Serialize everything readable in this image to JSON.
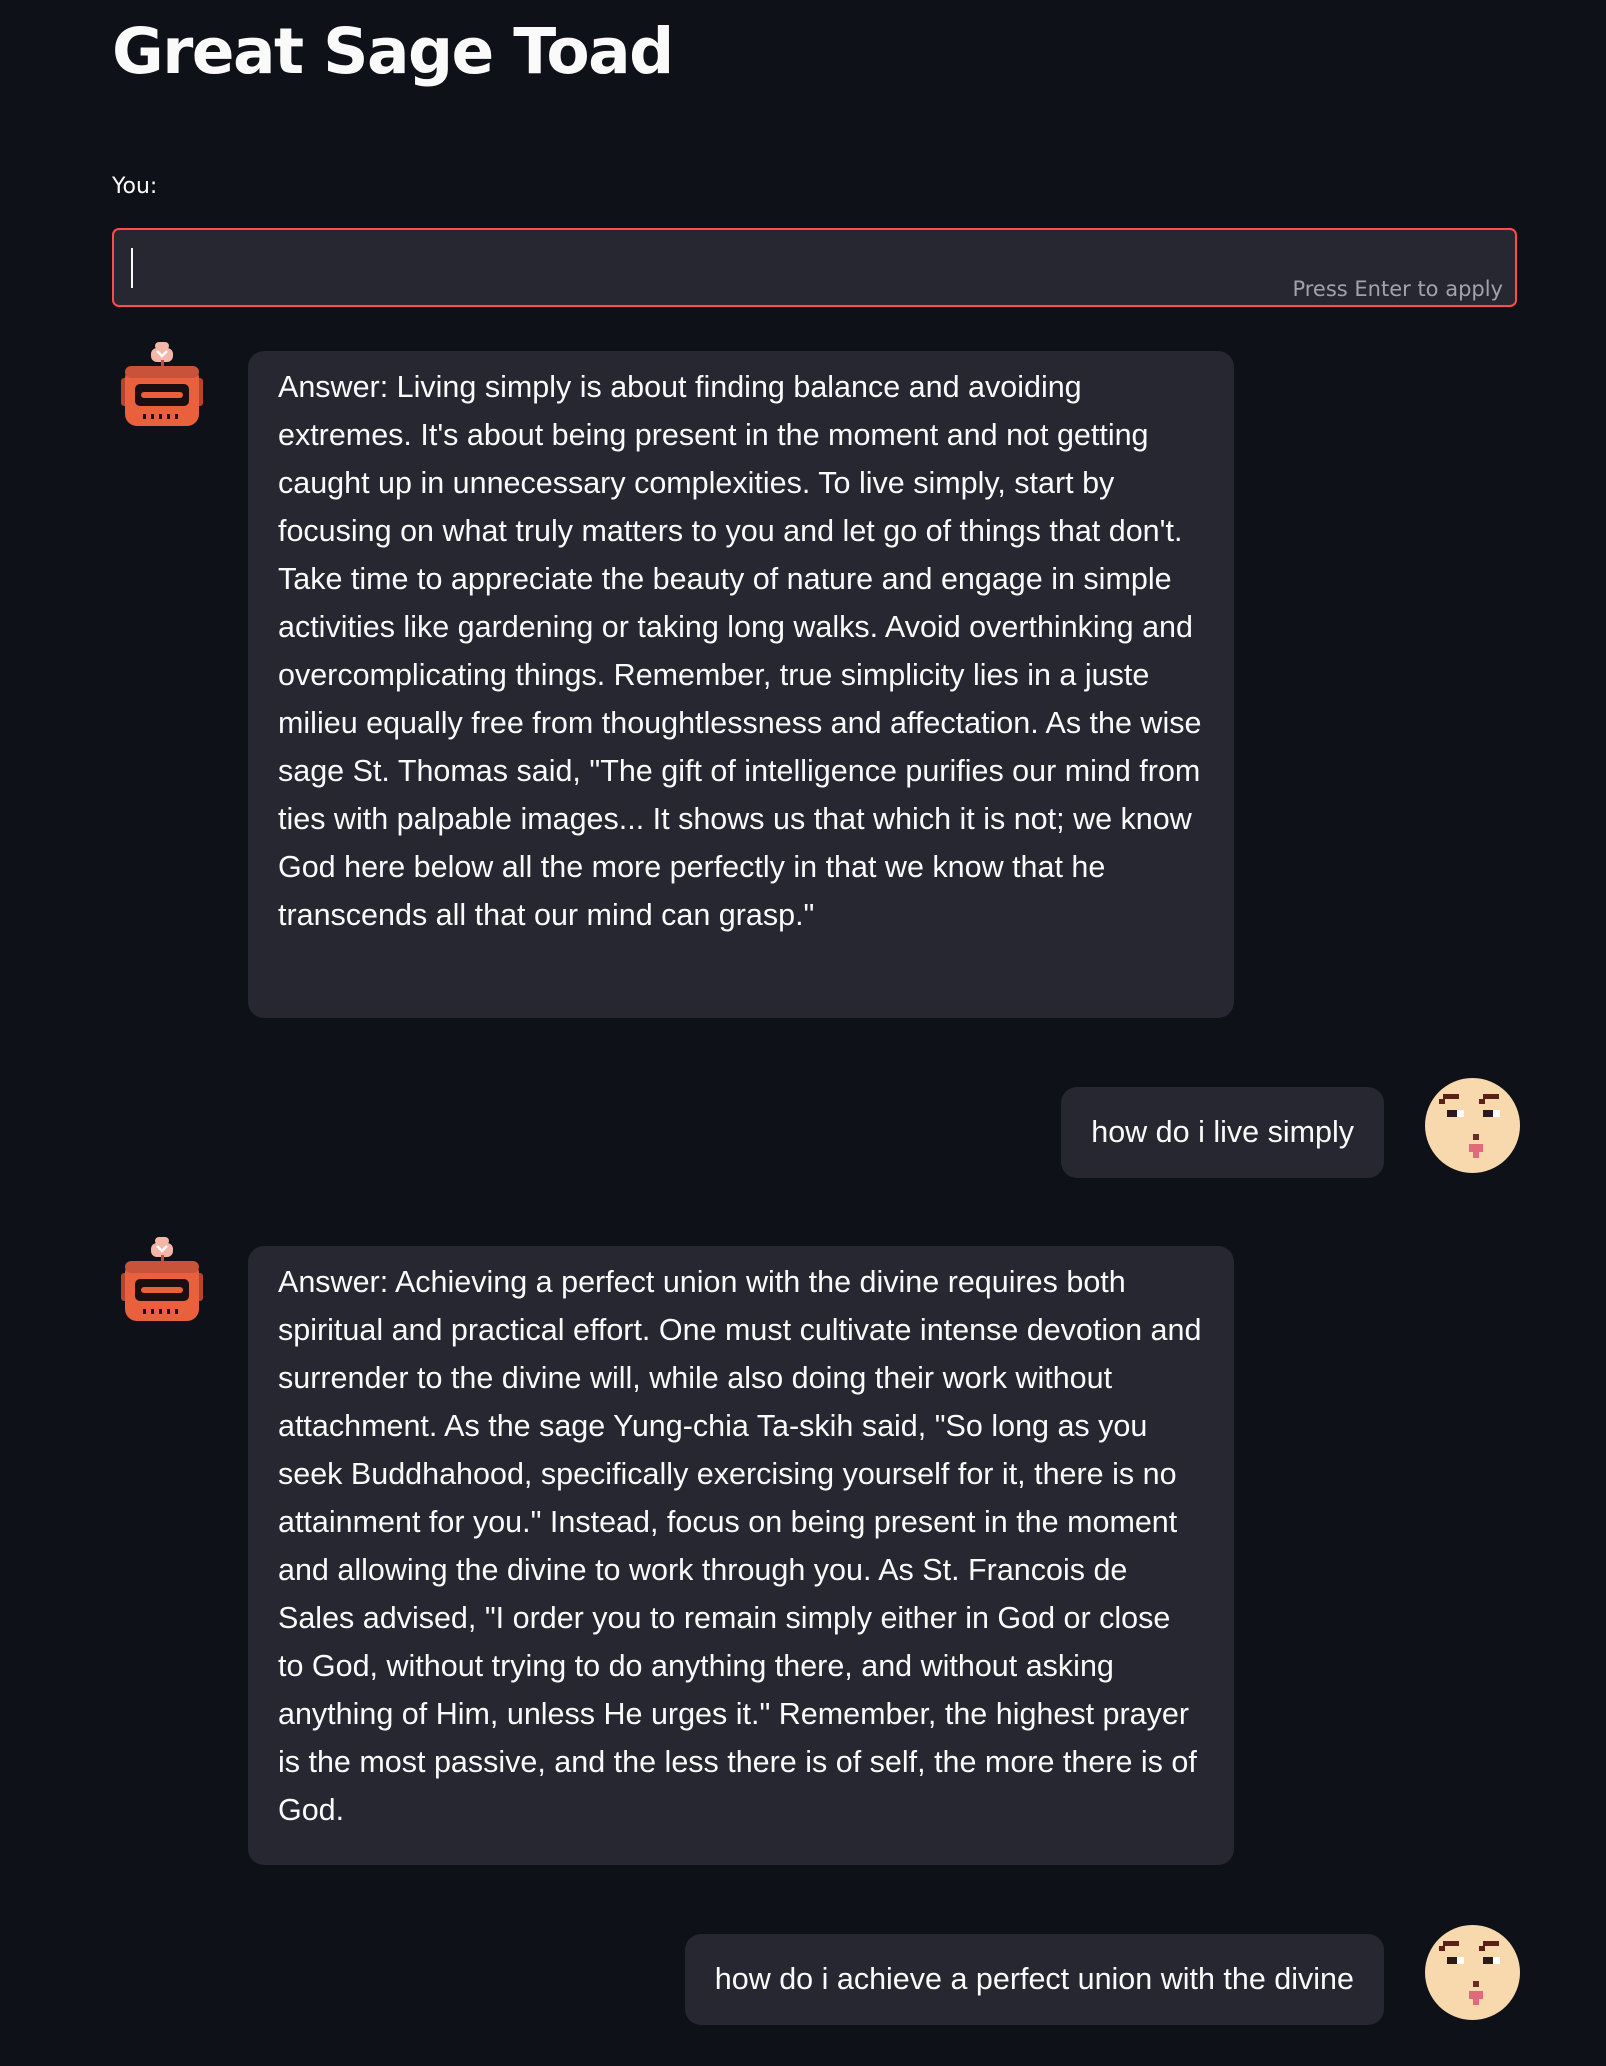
{
  "app": {
    "title": "Great Sage Toad"
  },
  "input": {
    "label": "You:",
    "value": "",
    "hint": "Press Enter to apply"
  },
  "messages": [
    {
      "role": "assistant",
      "avatar": "robot-avatar-icon",
      "text": "Answer: Living simply is about finding balance and avoiding extremes. It's about being present in the moment and not getting caught up in unnecessary complexities. To live simply, start by focusing on what truly matters to you and let go of things that don't. Take time to appreciate the beauty of nature and engage in simple activities like gardening or taking long walks. Avoid overthinking and overcomplicating things. Remember, true simplicity lies in a juste milieu equally free from thoughtlessness and affectation. As the wise sage St. Thomas said, \"The gift of intelligence purifies our mind from ties with palpable images... It shows us that which it is not; we know God here below all the more perfectly in that we know that he transcends all that our mind can grasp.\""
    },
    {
      "role": "user",
      "avatar": "face-avatar-icon",
      "text": "how do i live simply"
    },
    {
      "role": "assistant",
      "avatar": "robot-avatar-icon",
      "text": "Answer: Achieving a perfect union with the divine requires both spiritual and practical effort. One must cultivate intense devotion and surrender to the divine will, while also doing their work without attachment. As the sage Yung-chia Ta-skih said, \"So long as you seek Buddhahood, specifically exercising yourself for it, there is no attainment for you.\" Instead, focus on being present in the moment and allowing the divine to work through you. As St. Francois de Sales advised, \"I order you to remain simply either in God or close to God, without trying to do anything there, and without asking anything of Him, unless He urges it.\" Remember, the highest prayer is the most passive, and the less there is of self, the more there is of God."
    },
    {
      "role": "user",
      "avatar": "face-avatar-icon",
      "text": "how do i achieve a perfect union with the divine"
    }
  ],
  "colors": {
    "background": "#0e1117",
    "bubble": "#262730",
    "input_border_focus": "#ff4b4b",
    "text": "#fafafa",
    "hint": "#a0a3ab",
    "robot_orange": "#e8603c",
    "face_skin": "#f8d9ae"
  }
}
